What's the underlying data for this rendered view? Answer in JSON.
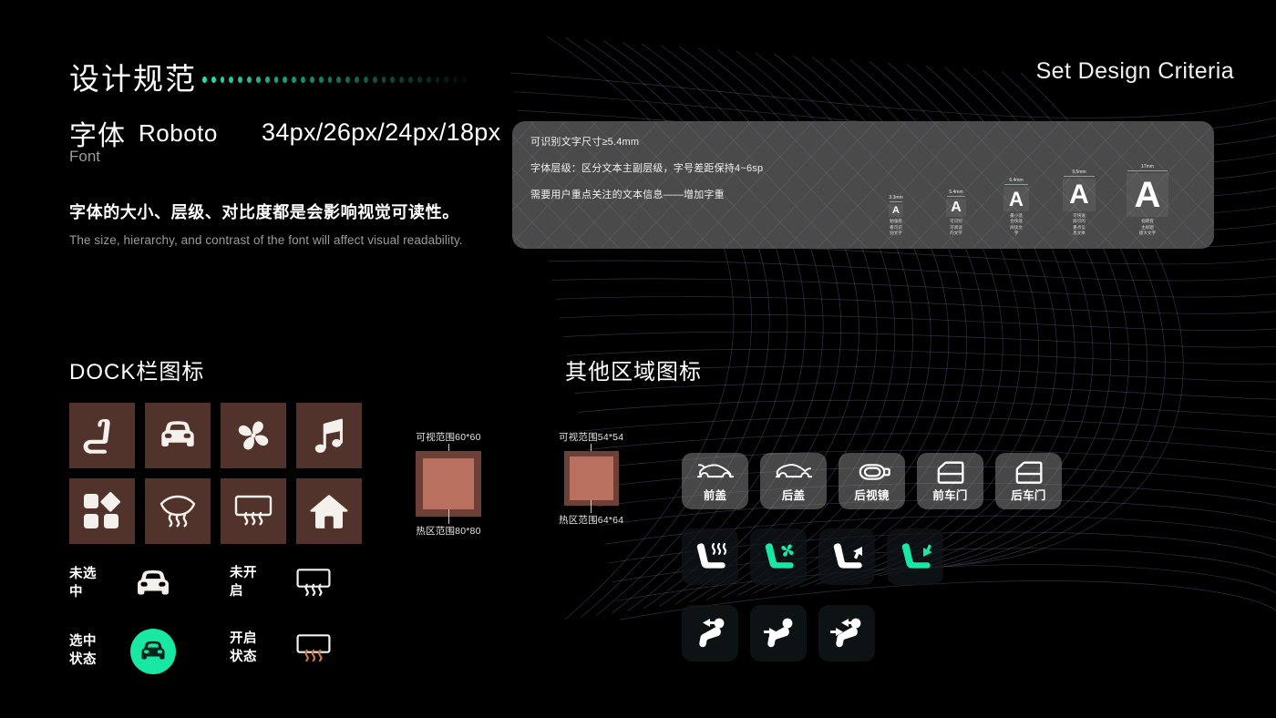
{
  "header": {
    "title_cn": "设计规范",
    "title_en": "Set Design Criteria",
    "dot_count": 30,
    "dot_color": "#23e0ad"
  },
  "font_spec": {
    "label_cn": "字体",
    "label_en": "Font",
    "family": "Roboto",
    "sizes": "34px/26px/24px/18px",
    "desc_cn": "字体的大小、层级、对比度都是会影响视觉可读性。",
    "desc_en": "The size, hierarchy, and contrast of the font will affect visual readability."
  },
  "panel": {
    "bg_color": "#4a4a4a",
    "lines": [
      "可识别文字尺寸≥5.4mm",
      "字体层级：区分文本主副层级，字号差距保持4~6sp",
      "需要用户重点关注的文本信息——增加字重"
    ],
    "samples": [
      {
        "mm": "3.3mm",
        "glyph": "A",
        "caption": "勉强能\n看可识\n别文字"
      },
      {
        "mm": "5.4mm",
        "glyph": "A",
        "caption": "可识别\n可阅读\n的文字"
      },
      {
        "mm": "6.4mm",
        "glyph": "A",
        "caption": "最小适\n合快速\n阅读文\n字"
      },
      {
        "mm": "9.5mm",
        "glyph": "A",
        "caption": "可快速\n辨识的\n重点信\n息文本"
      },
      {
        "mm": "17mm",
        "glyph": "A",
        "caption": "视距有\n主标题\n级大文字"
      }
    ]
  },
  "dock_section": {
    "title": "DOCK栏图标",
    "tile_color": "#52332c",
    "icons": [
      {
        "name": "seat-icon",
        "label": "座椅"
      },
      {
        "name": "car-front-icon",
        "label": "车辆"
      },
      {
        "name": "fan-icon",
        "label": "空调"
      },
      {
        "name": "music-note-icon",
        "label": "音乐"
      },
      {
        "name": "apps-grid-icon",
        "label": "应用"
      },
      {
        "name": "front-defrost-icon",
        "label": "前除霜"
      },
      {
        "name": "rear-defrost-icon",
        "label": "后除霜"
      },
      {
        "name": "home-icon",
        "label": "主页"
      }
    ],
    "states": [
      {
        "label": "未选\n中",
        "icon": "car-front-icon",
        "active": false
      },
      {
        "label": "选中\n状态",
        "icon": "car-front-icon",
        "active": true
      },
      {
        "label": "未开\n启",
        "icon": "rear-defrost-icon",
        "active": false
      },
      {
        "label": "开启\n状态",
        "icon": "rear-defrost-icon",
        "active": true
      }
    ],
    "accent_color": "#19e8a5"
  },
  "size_specs": [
    {
      "visible": "可视范围60*60",
      "hotzone": "热区范围80*80",
      "outer": 72,
      "inner": 56
    },
    {
      "visible": "可视范围54*54",
      "hotzone": "热区范围64*64",
      "outer": 60,
      "inner": 48
    }
  ],
  "other_section": {
    "title": "其他区域图标",
    "row1": [
      {
        "name": "hood-icon",
        "label": "前盖"
      },
      {
        "name": "trunk-icon",
        "label": "后盖"
      },
      {
        "name": "side-mirror-icon",
        "label": "后视镜"
      },
      {
        "name": "front-door-icon",
        "label": "前车门"
      },
      {
        "name": "rear-door-icon",
        "label": "后车门"
      }
    ],
    "row2": [
      {
        "name": "seat-heating-icon",
        "active": false
      },
      {
        "name": "seat-ventilation-icon",
        "active": true
      },
      {
        "name": "seat-adjust-back-icon",
        "active": false
      },
      {
        "name": "seat-adjust-forward-icon",
        "active": true
      }
    ],
    "row3": [
      {
        "name": "passenger-move-forward-icon",
        "active": false
      },
      {
        "name": "passenger-move-backward-icon",
        "active": false
      },
      {
        "name": "passenger-move-both-icon",
        "active": false
      }
    ]
  }
}
